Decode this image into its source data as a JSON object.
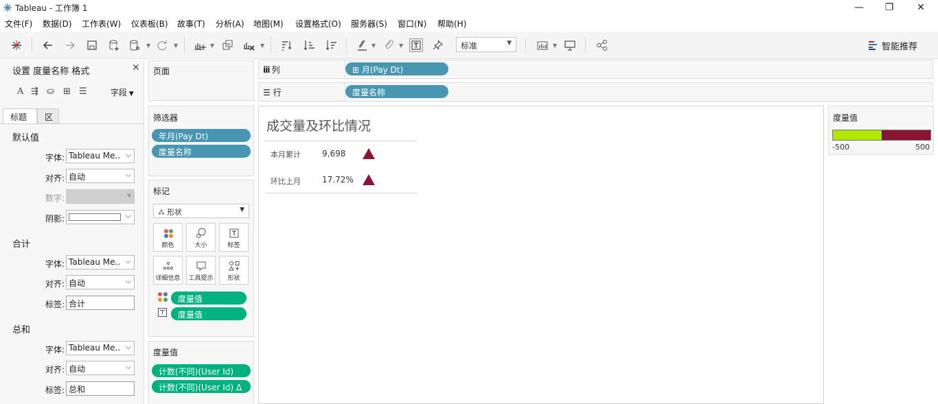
{
  "window": {
    "title": "Tableau - 工作簿 1",
    "minimize": "—",
    "restore": "❐",
    "close": "✕"
  },
  "menu": [
    "文件(F)",
    "数据(D)",
    "工作表(W)",
    "仪表板(B)",
    "故事(T)",
    "分析(A)",
    "地图(M)",
    "设置格式(O)",
    "服务器(S)",
    "窗口(N)",
    "帮助(H)"
  ],
  "toolbar": {
    "zoom_value": "标准",
    "smart_label": "智能推荐",
    "icons": [
      "tableau-logo-icon",
      "back-icon",
      "forward-icon",
      "save-icon",
      "new-datasource-icon",
      "pause-updates-icon",
      "refresh-icon",
      "new-worksheet-icon",
      "duplicate-sheet-icon",
      "clear-sheet-icon",
      "swap-rows-columns-icon",
      "sort-ascending-icon",
      "sort-descending-icon",
      "highlight-icon",
      "group-icon",
      "show-labels-icon",
      "fix-axes-icon",
      "show-cards-icon",
      "presentation-icon",
      "share-icon"
    ]
  },
  "format_pane": {
    "title": "设置 度量名称 格式",
    "field_menu": "字段",
    "tabs": [
      "标题",
      "区"
    ],
    "sections": [
      {
        "heading": "默认值",
        "rows": [
          {
            "label": "字体:",
            "value": "Tableau Me..",
            "type": "select"
          },
          {
            "label": "对齐:",
            "value": "自动",
            "type": "select"
          },
          {
            "label": "数字:",
            "value": "",
            "type": "select-disabled"
          },
          {
            "label": "阴影:",
            "value": "",
            "type": "shading"
          }
        ]
      },
      {
        "heading": "合计",
        "rows": [
          {
            "label": "字体:",
            "value": "Tableau Me..",
            "type": "select"
          },
          {
            "label": "对齐:",
            "value": "自动",
            "type": "select"
          },
          {
            "label": "标签:",
            "value": "合计",
            "type": "text"
          }
        ]
      },
      {
        "heading": "总和",
        "rows": [
          {
            "label": "字体:",
            "value": "Tableau Me..",
            "type": "select"
          },
          {
            "label": "对齐:",
            "value": "自动",
            "type": "select"
          },
          {
            "label": "标签:",
            "value": "总和",
            "type": "text"
          }
        ]
      }
    ]
  },
  "pages_card": {
    "title": "页面"
  },
  "filters_card": {
    "title": "筛选器",
    "pills": [
      "年月(Pay Dt)",
      "度量名称"
    ]
  },
  "marks_card": {
    "title": "标记",
    "mark_type": "形状",
    "buttons": [
      "颜色",
      "大小",
      "标签",
      "详细信息",
      "工具提示",
      "形状"
    ],
    "pills": [
      "度量值",
      "度量值"
    ]
  },
  "measure_values_card": {
    "title": "度量值",
    "pills": [
      "计数(不同)(User Id)",
      "计数(不同)(User Id)  Δ"
    ]
  },
  "columns_shelf": {
    "label": "列",
    "pill": "⊞ 月(Pay Dt)"
  },
  "rows_shelf": {
    "label": "行",
    "pill": "度量名称"
  },
  "viz": {
    "title": "成交量及环比情况",
    "rows": [
      {
        "label": "本月累计",
        "value": "9,698",
        "indicator": "up"
      },
      {
        "label": "环比上月",
        "value": "17.72%",
        "indicator": "up"
      }
    ],
    "indicator_color": "#8b1333"
  },
  "legend": {
    "title": "度量值",
    "min": "-500",
    "max": "500",
    "low_color": "#b3e600",
    "high_color": "#8b1333"
  }
}
